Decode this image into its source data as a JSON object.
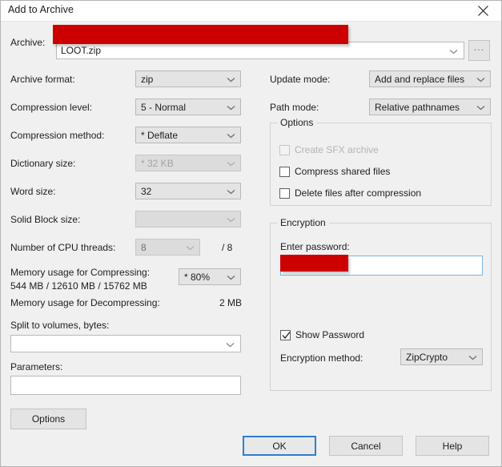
{
  "window": {
    "title": "Add to Archive",
    "close_icon": "close-icon"
  },
  "archive": {
    "label": "Archive:",
    "value": "LOOT.zip",
    "redacted_path": "",
    "browse_label": "...",
    "dropdown_icon": "chevron-down-icon"
  },
  "left_column": {
    "archive_format": {
      "label": "Archive format:",
      "value": "zip"
    },
    "compression_level": {
      "label": "Compression level:",
      "value": "5 - Normal"
    },
    "compression_method": {
      "label": "Compression method:",
      "value": "*  Deflate"
    },
    "dictionary_size": {
      "label": "Dictionary size:",
      "value": "*  32 KB",
      "disabled": true
    },
    "word_size": {
      "label": "Word size:",
      "value": "32"
    },
    "solid_block_size": {
      "label": "Solid Block size:",
      "value": "",
      "disabled": true
    },
    "cpu_threads": {
      "label": "Number of CPU threads:",
      "value": "8",
      "max": "/ 8",
      "disabled": true
    },
    "memory_compressing": {
      "label": "Memory usage for Compressing:",
      "detail": "544 MB / 12610 MB / 15762 MB",
      "value": "* 80%"
    },
    "memory_decompressing": {
      "label": "Memory usage for Decompressing:",
      "value": "2 MB"
    },
    "split_volumes": {
      "label": "Split to volumes, bytes:",
      "value": ""
    },
    "parameters": {
      "label": "Parameters:",
      "value": ""
    }
  },
  "right_column": {
    "update_mode": {
      "label": "Update mode:",
      "value": "Add and replace files"
    },
    "path_mode": {
      "label": "Path mode:",
      "value": "Relative pathnames"
    },
    "options_group": {
      "title": "Options",
      "items": [
        {
          "label": "Create SFX archive",
          "checked": false,
          "disabled": true
        },
        {
          "label": "Compress shared files",
          "checked": false,
          "disabled": false
        },
        {
          "label": "Delete files after compression",
          "checked": false,
          "disabled": false
        }
      ]
    },
    "encryption_group": {
      "title": "Encryption",
      "password_label": "Enter password:",
      "password_value": "",
      "show_password": {
        "label": "Show Password",
        "checked": true
      },
      "encryption_method": {
        "label": "Encryption method:",
        "value": "ZipCrypto"
      }
    }
  },
  "footer": {
    "options_label": "Options",
    "ok_label": "OK",
    "cancel_label": "Cancel",
    "help_label": "Help"
  },
  "colors": {
    "redaction": "#cc0000",
    "dialog_bg": "#f0f0f0",
    "focus_border": "#2a7fd4"
  }
}
